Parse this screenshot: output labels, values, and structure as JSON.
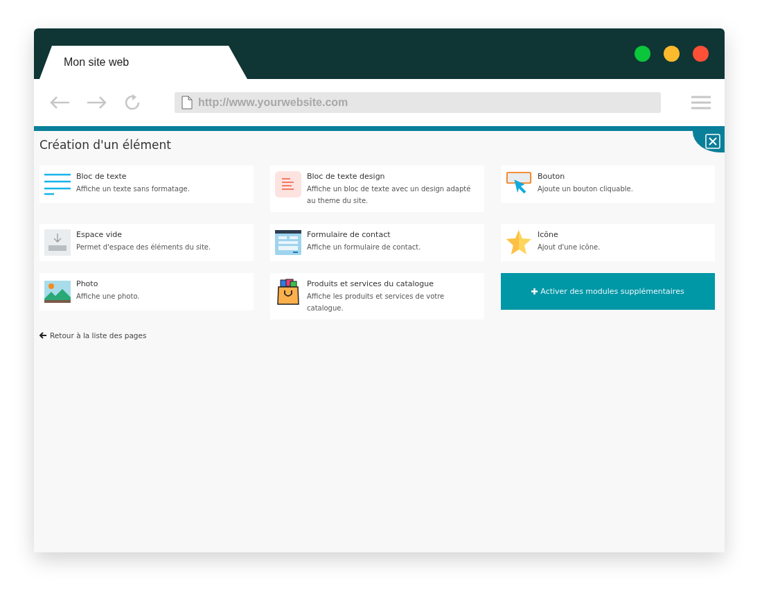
{
  "browser": {
    "tab_title": "Mon site web",
    "url": "http://www.**yourwebsite**.com"
  },
  "panel": {
    "title": "Création d'un élément",
    "elements": [
      {
        "kind": "text",
        "title": "Bloc de texte",
        "description": "Affiche un texte sans formatage."
      },
      {
        "kind": "design",
        "title": "Bloc de texte design",
        "description": "Affiche un bloc de texte avec un design adapté au theme du site."
      },
      {
        "kind": "button",
        "title": "Bouton",
        "description": "Ajoute un bouton cliquable."
      },
      {
        "kind": "spacer",
        "title": "Espace vide",
        "description": "Permet d'espace des éléments du site."
      },
      {
        "kind": "form",
        "title": "Formulaire de contact",
        "description": "Affiche un formulaire de contact."
      },
      {
        "kind": "star",
        "title": "Icône",
        "description": "Ajout d'une icône."
      },
      {
        "kind": "photo",
        "title": "Photo",
        "description": "Affiche une photo."
      },
      {
        "kind": "bag",
        "title": "Produits et services du catalogue",
        "description": "Affiche les produits et services de votre catalogue."
      }
    ],
    "more_button": "Activer des modules supplémentaires",
    "back_link": "Retour à la liste des pages"
  }
}
